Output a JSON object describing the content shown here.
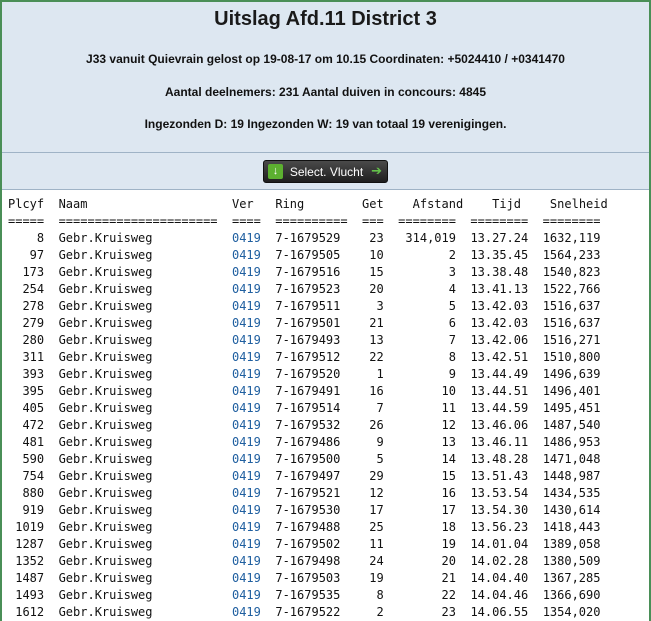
{
  "header": {
    "title": "Uitslag Afd.11 District 3",
    "release_info": "J33 vanuit Quievrain gelost op 19-08-17 om 10.15 Coordinaten: +5024410 / +0341470",
    "participants": "Aantal deelnemers: 231 Aantal duiven in concours: 4845",
    "submitted": "Ingezonden D: 19 Ingezonden W: 19 van totaal 19 verenigingen."
  },
  "toolbar": {
    "select_flight_label": "Select. Vlucht",
    "download_icon": "download-icon",
    "arrow_icon": "arrow-right-icon"
  },
  "colors": {
    "border": "#4a8f57",
    "header_bg": "#dde7f1",
    "link": "#1f5fa0"
  },
  "table": {
    "columns": [
      "Plcyf",
      "Naam",
      "Ver",
      "Ring",
      "Get",
      "Afstand",
      "Tijd",
      "Snelheid"
    ],
    "rows": [
      [
        "8",
        "Gebr.Kruisweg",
        "0419",
        "7-1679529",
        "23",
        "314,019",
        "13.27.24",
        "1632,119"
      ],
      [
        "97",
        "Gebr.Kruisweg",
        "0419",
        "7-1679505",
        "10",
        "2",
        "13.35.45",
        "1564,233"
      ],
      [
        "173",
        "Gebr.Kruisweg",
        "0419",
        "7-1679516",
        "15",
        "3",
        "13.38.48",
        "1540,823"
      ],
      [
        "254",
        "Gebr.Kruisweg",
        "0419",
        "7-1679523",
        "20",
        "4",
        "13.41.13",
        "1522,766"
      ],
      [
        "278",
        "Gebr.Kruisweg",
        "0419",
        "7-1679511",
        "3",
        "5",
        "13.42.03",
        "1516,637"
      ],
      [
        "279",
        "Gebr.Kruisweg",
        "0419",
        "7-1679501",
        "21",
        "6",
        "13.42.03",
        "1516,637"
      ],
      [
        "280",
        "Gebr.Kruisweg",
        "0419",
        "7-1679493",
        "13",
        "7",
        "13.42.06",
        "1516,271"
      ],
      [
        "311",
        "Gebr.Kruisweg",
        "0419",
        "7-1679512",
        "22",
        "8",
        "13.42.51",
        "1510,800"
      ],
      [
        "393",
        "Gebr.Kruisweg",
        "0419",
        "7-1679520",
        "1",
        "9",
        "13.44.49",
        "1496,639"
      ],
      [
        "395",
        "Gebr.Kruisweg",
        "0419",
        "7-1679491",
        "16",
        "10",
        "13.44.51",
        "1496,401"
      ],
      [
        "405",
        "Gebr.Kruisweg",
        "0419",
        "7-1679514",
        "7",
        "11",
        "13.44.59",
        "1495,451"
      ],
      [
        "472",
        "Gebr.Kruisweg",
        "0419",
        "7-1679532",
        "26",
        "12",
        "13.46.06",
        "1487,540"
      ],
      [
        "481",
        "Gebr.Kruisweg",
        "0419",
        "7-1679486",
        "9",
        "13",
        "13.46.11",
        "1486,953"
      ],
      [
        "590",
        "Gebr.Kruisweg",
        "0419",
        "7-1679500",
        "5",
        "14",
        "13.48.28",
        "1471,048"
      ],
      [
        "754",
        "Gebr.Kruisweg",
        "0419",
        "7-1679497",
        "29",
        "15",
        "13.51.43",
        "1448,987"
      ],
      [
        "880",
        "Gebr.Kruisweg",
        "0419",
        "7-1679521",
        "12",
        "16",
        "13.53.54",
        "1434,535"
      ],
      [
        "919",
        "Gebr.Kruisweg",
        "0419",
        "7-1679530",
        "17",
        "17",
        "13.54.30",
        "1430,614"
      ],
      [
        "1019",
        "Gebr.Kruisweg",
        "0419",
        "7-1679488",
        "25",
        "18",
        "13.56.23",
        "1418,443"
      ],
      [
        "1287",
        "Gebr.Kruisweg",
        "0419",
        "7-1679502",
        "11",
        "19",
        "14.01.04",
        "1389,058"
      ],
      [
        "1352",
        "Gebr.Kruisweg",
        "0419",
        "7-1679498",
        "24",
        "20",
        "14.02.28",
        "1380,509"
      ],
      [
        "1487",
        "Gebr.Kruisweg",
        "0419",
        "7-1679503",
        "19",
        "21",
        "14.04.40",
        "1367,285"
      ],
      [
        "1493",
        "Gebr.Kruisweg",
        "0419",
        "7-1679535",
        "8",
        "22",
        "14.04.46",
        "1366,690"
      ],
      [
        "1612",
        "Gebr.Kruisweg",
        "0419",
        "7-1679522",
        "2",
        "23",
        "14.06.55",
        "1354,020"
      ]
    ]
  }
}
